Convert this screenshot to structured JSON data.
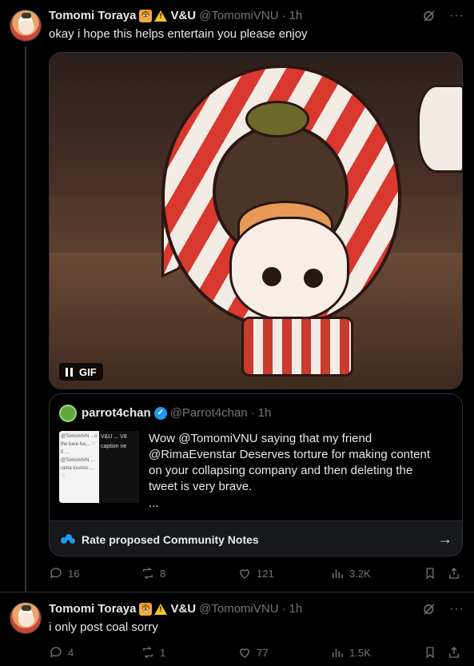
{
  "tweets": [
    {
      "author_name": "Tomomi Toraya",
      "org": "V&U",
      "handle": "@TomomiVNU",
      "time": "1h",
      "text": "okay i hope this helps entertain you please enjoy",
      "media_badge": "GIF",
      "quote": {
        "author_name": "parrot4chan",
        "handle": "@Parrot4chan",
        "time": "1h",
        "thumb_left": "@TomomiVN ...o the bare fuc... ♡ 5 ... @TomomiVN ... rama tourists ... ♡",
        "thumb_right": "V&U ... V8 caption ne",
        "text": "Wow @TomomiVNU saying that my friend @RimaEvenstar Deserves torture for making content on your collapsing company and then deleting the tweet is very brave.",
        "more": "...",
        "notes_label": "Rate proposed Community Notes"
      },
      "stats": {
        "replies": "16",
        "reposts": "8",
        "likes": "121",
        "views": "3.2K"
      }
    },
    {
      "author_name": "Tomomi Toraya",
      "org": "V&U",
      "handle": "@TomomiVNU",
      "time": "1h",
      "text": "i only post coal sorry",
      "stats": {
        "replies": "4",
        "reposts": "1",
        "likes": "77",
        "views": "1.5K"
      }
    }
  ],
  "colors": {
    "background": "#000000",
    "text": "#e7e9ea",
    "muted": "#71767b",
    "accent": "#1d9bf0",
    "border": "#2f3336"
  },
  "icons": [
    "grok-icon",
    "more-icon",
    "pause-icon",
    "verified-icon",
    "people-icon",
    "arrow-right-icon",
    "reply-icon",
    "repost-icon",
    "like-icon",
    "views-icon",
    "bookmark-icon",
    "share-icon"
  ]
}
